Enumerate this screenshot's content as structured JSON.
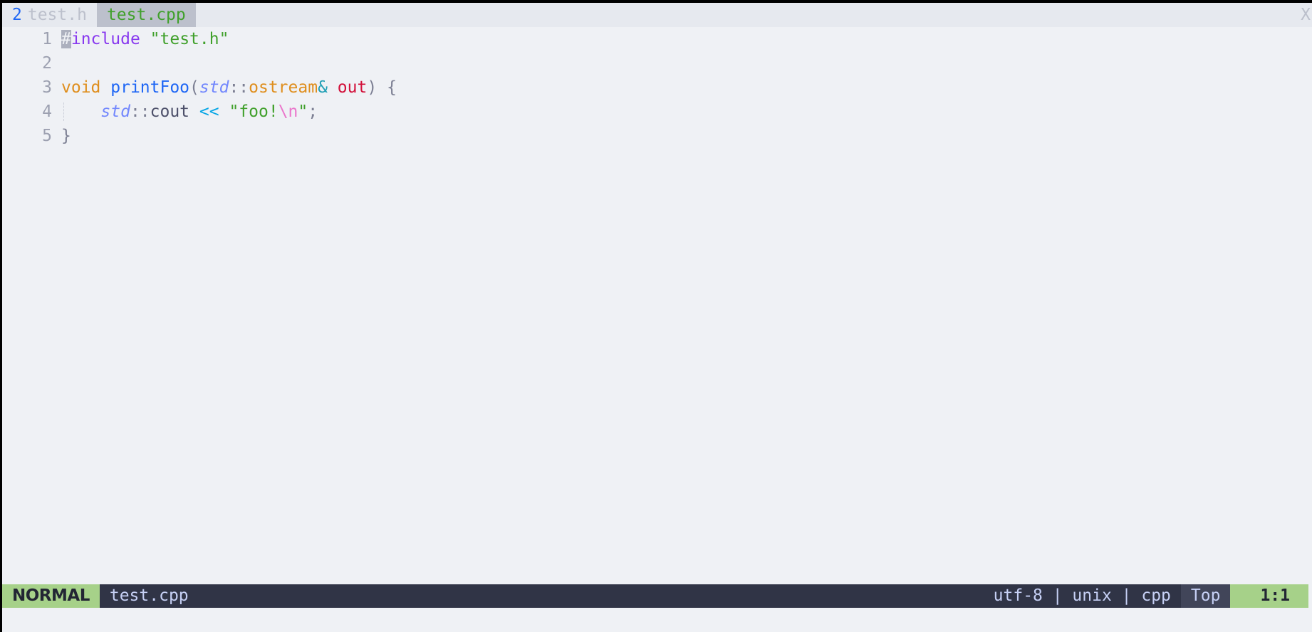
{
  "tabline": {
    "buffer_count": "2",
    "tabs": [
      {
        "label": "test.h",
        "active": false
      },
      {
        "label": "test.cpp",
        "active": true
      }
    ],
    "close_label": "X"
  },
  "editor": {
    "lines": [
      {
        "number": "1",
        "tokens": [
          "#",
          "include",
          " ",
          "\"test.h\""
        ]
      },
      {
        "number": "2",
        "tokens": []
      },
      {
        "number": "3",
        "tokens": [
          "void",
          " ",
          "printFoo",
          "(",
          "std",
          "::",
          "ostream",
          "&",
          " ",
          "out",
          ")",
          " ",
          "{"
        ]
      },
      {
        "number": "4",
        "tokens": [
          "    ",
          "std",
          "::",
          "cout",
          " ",
          "<<",
          " ",
          "\"foo!",
          "\\n",
          "\"",
          ";"
        ]
      },
      {
        "number": "5",
        "tokens": [
          "}"
        ]
      }
    ]
  },
  "statusline": {
    "mode": "NORMAL",
    "filename": "test.cpp",
    "info": "utf-8 | unix | cpp",
    "scroll": "Top",
    "position": "1:1"
  },
  "colors": {
    "background": "#eff1f5",
    "mode_normal": "#a6d189",
    "statusline_bg": "#303446"
  }
}
